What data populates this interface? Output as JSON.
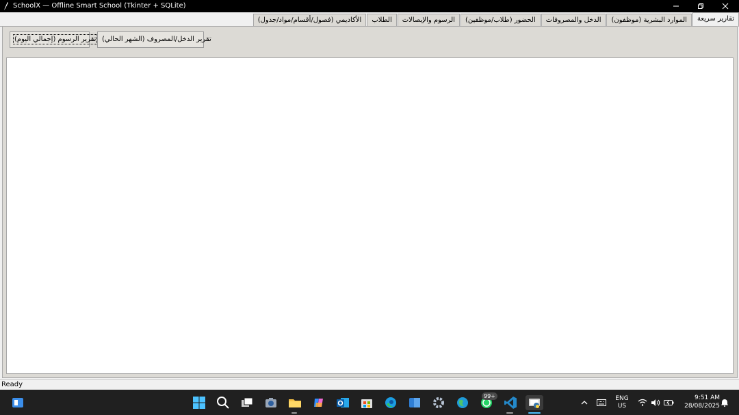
{
  "window": {
    "title": "SchoolX — Offline Smart School (Tkinter + SQLite)"
  },
  "tabs": [
    {
      "label": "تقارير سريعة",
      "active": true
    },
    {
      "label": "الموارد البشرية (موظفون)",
      "active": false
    },
    {
      "label": "الدخل والمصروفات",
      "active": false
    },
    {
      "label": "الحضور (طلاب/موظفين)",
      "active": false
    },
    {
      "label": "الرسوم والإيصالات",
      "active": false
    },
    {
      "label": "الطلاب",
      "active": false
    },
    {
      "label": "الأكاديمي (فصول/أقسام/مواد/جدول)",
      "active": false
    }
  ],
  "reports": {
    "fees_button": "تقرير الرسوم (إجمالي اليوم)",
    "income_expense_button": "تقرير الدخل/المصروف (الشهر الحالي)"
  },
  "status": {
    "text": "Ready"
  },
  "taskbar": {
    "badge": "99+",
    "lang_line1": "ENG",
    "lang_line2": "US",
    "time": "9:51 AM",
    "date": "28/08/2025"
  },
  "colors": {
    "accent": "#0078d4",
    "titlebar": "#000000",
    "taskbar": "#202020"
  }
}
